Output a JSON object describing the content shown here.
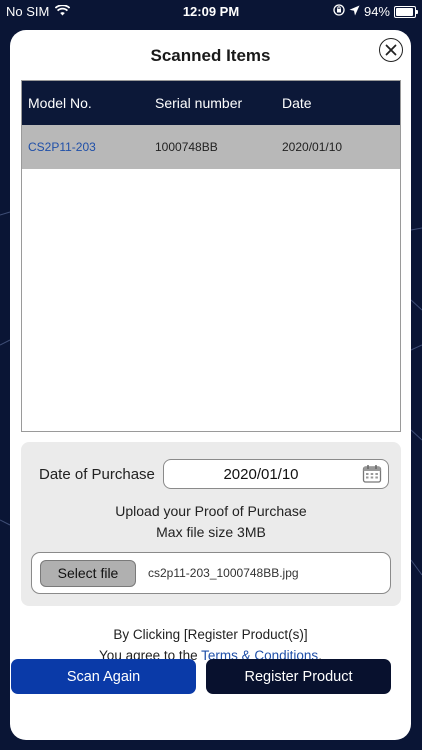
{
  "status_bar": {
    "carrier": "No SIM",
    "time": "12:09 PM",
    "battery": "94%",
    "battery_level": 0.94
  },
  "modal": {
    "title": "Scanned Items"
  },
  "table": {
    "headers": [
      "Model No.",
      "Serial number",
      "Date"
    ],
    "rows": [
      {
        "model": "CS2P11-203",
        "serial": "1000748BB",
        "date": "2020/01/10"
      }
    ]
  },
  "purchase": {
    "date_label": "Date of Purchase",
    "date_value": "2020/01/10",
    "upload_line1": "Upload your Proof of Purchase",
    "upload_line2": "Max file size 3MB",
    "select_file_label": "Select file",
    "file_name": "cs2p11-203_1000748BB.jpg"
  },
  "agreement": {
    "line1": "By Clicking [Register Product(s)]",
    "line2_prefix": "You agree to the ",
    "terms_link": "Terms & Conditions",
    "line2_suffix": "."
  },
  "buttons": {
    "scan_again": "Scan Again",
    "register": "Register Product"
  },
  "colors": {
    "background": "#0a1535",
    "table_header": "#0c1838",
    "scan_again": "#0a3aa8",
    "register": "#08112e",
    "link": "#1f4fa8"
  }
}
